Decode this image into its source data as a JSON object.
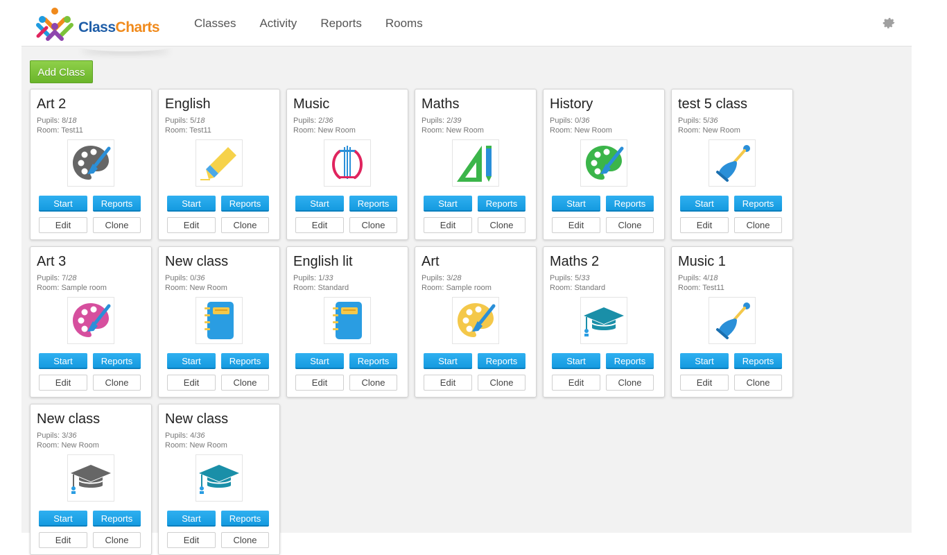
{
  "app": {
    "brand_part1": "Class",
    "brand_part2": "Charts",
    "nav": [
      "Classes",
      "Activity",
      "Reports",
      "Rooms"
    ],
    "settings_icon": "gear-icon",
    "add_class_label": "Add Class"
  },
  "labels": {
    "pupils": "Pupils:",
    "room": "Room:",
    "start": "Start",
    "reports": "Reports",
    "edit": "Edit",
    "clone": "Clone"
  },
  "classes": [
    {
      "name": "Art 2",
      "pupils": "8",
      "capacity": "18",
      "room": "Test11",
      "icon": "palette-gray-icon"
    },
    {
      "name": "English",
      "pupils": "5",
      "capacity": "18",
      "room": "Test11",
      "icon": "highlighter-icon"
    },
    {
      "name": "Music",
      "pupils": "2",
      "capacity": "36",
      "room": "New Room",
      "icon": "lyre-icon"
    },
    {
      "name": "Maths",
      "pupils": "2",
      "capacity": "39",
      "room": "New Room",
      "icon": "ruler-pencil-icon"
    },
    {
      "name": "History",
      "pupils": "0",
      "capacity": "36",
      "room": "New Room",
      "icon": "palette-green-icon"
    },
    {
      "name": "test 5 class",
      "pupils": "5",
      "capacity": "36",
      "room": "New Room",
      "icon": "bell-icon"
    },
    {
      "name": "Art 3",
      "pupils": "7",
      "capacity": "28",
      "room": "Sample room",
      "icon": "palette-pink-icon"
    },
    {
      "name": "New class",
      "pupils": "0",
      "capacity": "36",
      "room": "New Room",
      "icon": "notebook-icon"
    },
    {
      "name": "English lit",
      "pupils": "1",
      "capacity": "33",
      "room": "Standard",
      "icon": "notebook-icon"
    },
    {
      "name": "Art",
      "pupils": "3",
      "capacity": "28",
      "room": "Sample room",
      "icon": "palette-yellow-icon"
    },
    {
      "name": "Maths 2",
      "pupils": "5",
      "capacity": "33",
      "room": "Standard",
      "icon": "graduation-cap-teal-icon"
    },
    {
      "name": "Music 1",
      "pupils": "4",
      "capacity": "18",
      "room": "Test11",
      "icon": "bell-icon"
    },
    {
      "name": "New class",
      "pupils": "3",
      "capacity": "36",
      "room": "New Room",
      "icon": "graduation-cap-gray-icon"
    },
    {
      "name": "New class",
      "pupils": "4",
      "capacity": "36",
      "room": "New Room",
      "icon": "graduation-cap-teal-icon"
    }
  ],
  "colors": {
    "start_button": "#1aa3e8",
    "add_button": "#7cc23a",
    "brand_blue": "#1f5ea8",
    "brand_orange": "#f08a1c"
  }
}
